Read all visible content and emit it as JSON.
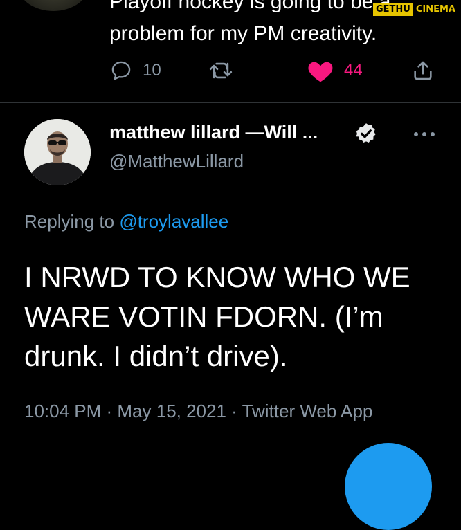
{
  "watermark": {
    "part1": "GETHU",
    "part2": "CINEMA"
  },
  "previous_tweet": {
    "text": "Playoff hockey is going to be a\nproblem for my PM creativity.",
    "actions": {
      "reply_count": "10",
      "like_count": "44"
    }
  },
  "tweet": {
    "author_name": "matthew lillard —Will ...",
    "handle": "@MatthewLillard",
    "replying_prefix": "Replying to ",
    "replying_to": "@troylavallee",
    "text": "I NRWD TO KNOW WHO WE WARE VOTIN FDORN. (I’m drunk. I didn’t drive).",
    "timestamp_line": "10:04 PM · May 15, 2021 · Twitter Web App"
  },
  "colors": {
    "background": "#000000",
    "secondary_text": "#8b98a5",
    "link": "#1d9bf0",
    "like": "#f91880"
  },
  "icons": [
    "reply-icon",
    "retweet-icon",
    "like-icon",
    "share-icon",
    "verified-badge-icon",
    "more-options-icon"
  ]
}
